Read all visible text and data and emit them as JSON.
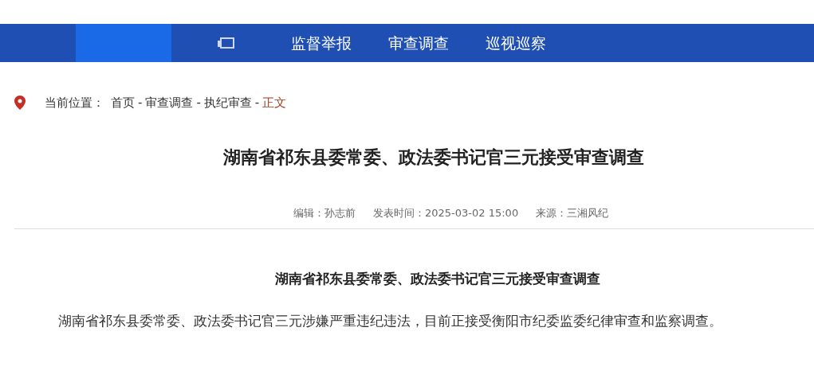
{
  "nav": {
    "items": [
      {
        "label": "监督举报"
      },
      {
        "label": "审查调查"
      },
      {
        "label": "巡视巡察"
      }
    ]
  },
  "breadcrumb": {
    "label": "当前位置：",
    "separator": "-",
    "items": [
      {
        "label": "首页",
        "current": false
      },
      {
        "label": "审查调查",
        "current": false
      },
      {
        "label": "执纪审查",
        "current": false
      },
      {
        "label": "正文",
        "current": true
      }
    ]
  },
  "article": {
    "title": "湖南省祁东县委常委、政法委书记官三元接受审查调查",
    "meta": [
      {
        "label": "编辑：孙志前"
      },
      {
        "label": "发表时间：2025-03-02 15:00"
      },
      {
        "label": "来源：三湘风纪"
      }
    ],
    "subtitle": "湖南省祁东县委常委、政法委书记官三元接受审查调查",
    "body": "湖南省祁东县委常委、政法委书记官三元涉嫌严重违纪违法，目前正接受衡阳市纪委监委纪律审查和监察调查。"
  }
}
